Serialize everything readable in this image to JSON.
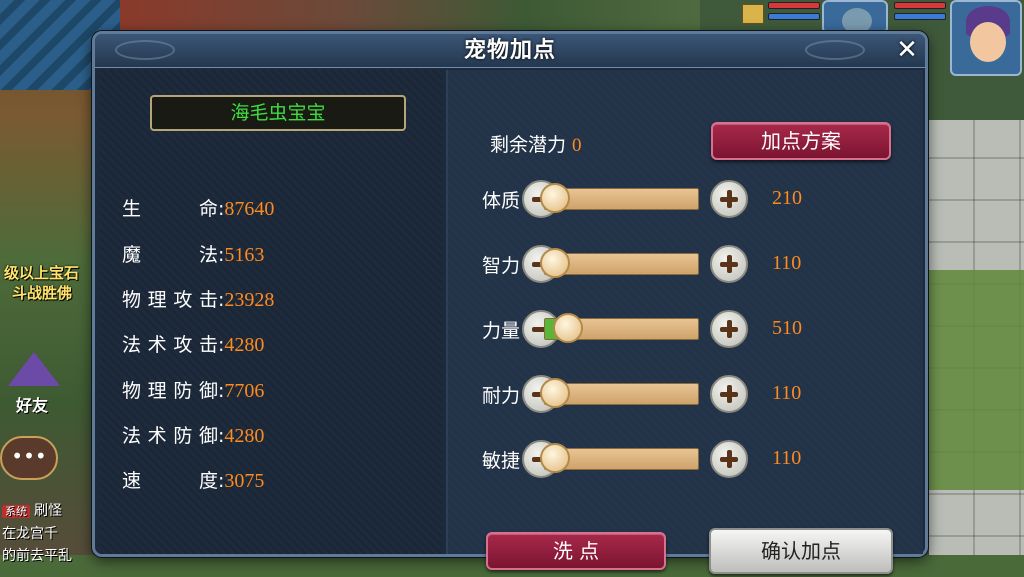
{
  "hud": {
    "left_text_1": "级以上宝石",
    "left_text_2": "斗战胜佛",
    "friend_label": "好友",
    "chat_icon": "speech-bubble-icon",
    "chat_line_1_tag": "系统",
    "chat_line_1": "刷怪",
    "chat_line_2": "在龙宫千",
    "chat_line_3": "的前去平乱"
  },
  "dialog": {
    "title": "宠物加点",
    "close_icon": "close-icon"
  },
  "pet": {
    "name": "海毛虫宝宝",
    "stats": [
      {
        "label": "生命",
        "value": "87640"
      },
      {
        "label": "魔法",
        "value": "5163"
      },
      {
        "label": "物理攻击",
        "value": "23928"
      },
      {
        "label": "法术攻击",
        "value": "4280"
      },
      {
        "label": "物理防御",
        "value": "7706"
      },
      {
        "label": "法术防御",
        "value": "4280"
      },
      {
        "label": "速度",
        "value": "3075"
      }
    ]
  },
  "points": {
    "remaining_label": "剩余潜力",
    "remaining_value": "0",
    "plan_button": "加点方案",
    "attributes": [
      {
        "name": "体质",
        "value": "210",
        "level": 0.0,
        "bonus": 0.0
      },
      {
        "name": "智力",
        "value": "110",
        "level": 0.0,
        "bonus": 0.0
      },
      {
        "name": "力量",
        "value": "510",
        "level": 0.1,
        "bonus": 0.1
      },
      {
        "name": "耐力",
        "value": "110",
        "level": 0.0,
        "bonus": 0.0
      },
      {
        "name": "敏捷",
        "value": "110",
        "level": 0.0,
        "bonus": 0.0
      }
    ],
    "reset_button": "洗 点",
    "confirm_button": "确认加点"
  },
  "colors": {
    "accent_orange": "#ff8a1e",
    "name_green": "#3fdc3f",
    "button_red": "#a8284a"
  }
}
